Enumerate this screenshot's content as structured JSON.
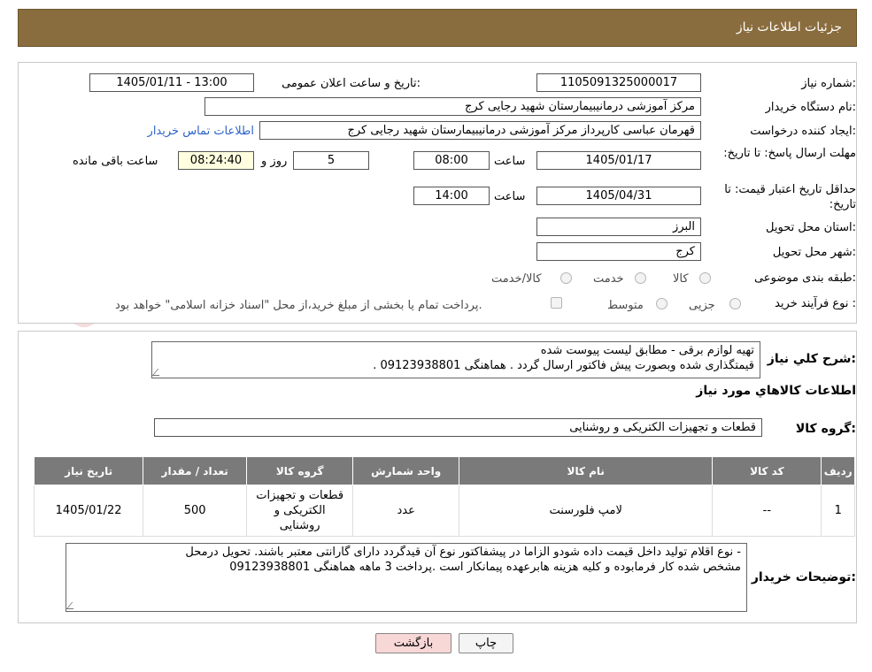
{
  "header": {
    "title": "جزئیات اطلاعات نیاز"
  },
  "form": {
    "need_number_label": "شماره نیاز:",
    "need_number": "1105091325000017",
    "announce_label": "تاریخ و ساعت اعلان عمومی:",
    "announce_value": "1405/01/11 - 13:00",
    "buyer_org_label": "نام دستگاه خریدار:",
    "buyer_org": "مرکز آموزشی درمانیبیمارستان شهید رجایی کرج",
    "creator_label": "ایجاد کننده درخواست:",
    "creator": "قهرمان عباسی کارپرداز مرکز آموزشی درمانیبیمارستان شهید رجایی کرج",
    "contact_link": "اطلاعات تماس خریدار",
    "deadline_label": "مهلت ارسال پاسخ: تا تاریخ:",
    "deadline_date": "1405/01/17",
    "time_word": "ساعت",
    "deadline_time": "08:00",
    "days_value": "5",
    "days_word": "روز و",
    "remaining_time": "08:24:40",
    "remaining_word": "ساعت باقی مانده",
    "validity_label": "حداقل تاریخ اعتبار قیمت: تا تاریخ:",
    "validity_date": "1405/04/31",
    "validity_time": "14:00",
    "province_label": "استان محل تحویل:",
    "province": "البرز",
    "city_label": "شهر محل تحویل:",
    "city": "کرج",
    "category_label": "طبقه بندی موضوعی:",
    "cat_goods": "کالا",
    "cat_service": "خدمت",
    "cat_both": "کالا/خدمت",
    "process_label": "نوع فرآیند خرید :",
    "proc_partial": "جزیی",
    "proc_medium": "متوسط",
    "proc_note": "پرداخت تمام یا بخشی از مبلغ خرید،از محل \"اسناد خزانه اسلامی\" خواهد بود."
  },
  "summary": {
    "label": "شرح کلي نياز:",
    "line1": "تهیه لوازم برقی -  مطابق لیست پیوست شده",
    "line2": "قیمتگذاری شده وبصورت پیش فاکتور  ارسال گردد . هماهنگی  09123938801 .",
    "goods_info_title": "اطلاعات کالاهاي مورد نياز",
    "group_label": "گروه کالا:",
    "group_value": "قطعات و تجهیزات الکتریکی و روشنایی"
  },
  "table": {
    "headers": [
      "ردیف",
      "کد کالا",
      "نام کالا",
      "واحد شمارش",
      "گروه کالا",
      "تعداد / مقدار",
      "تاریخ نیاز"
    ],
    "row": {
      "index": "1",
      "code": "--",
      "name": "لامپ فلورسنت",
      "unit": "عدد",
      "group": "قطعات و تجهیزات الکتریکی و روشنایی",
      "qty": "500",
      "date": "1405/01/22"
    }
  },
  "notes": {
    "label": "توضیحات خریدار:",
    "line1": "- نوع اقلام تولید داخل قیمت داده شودو الزاما در پیشفاکتور نوع آن قیدگردد  دارای گارانتی معتبر باشند. تحویل درمحل",
    "line2": "مشخص شده کار فرمابوده و کلیه هزینه هابرعهده پیمانکار است .پرداخت  3 ماهه  هماهنگی 09123938801"
  },
  "buttons": {
    "print": "چاپ",
    "back": "بازگشت"
  },
  "watermark": {
    "text": "AriaTender.neT"
  },
  "colors": {
    "header_bg": "#8a6d3e",
    "table_header_bg": "#7a7a7a",
    "back_button_bg": "#f8d7d7",
    "link": "#2d63c8"
  }
}
